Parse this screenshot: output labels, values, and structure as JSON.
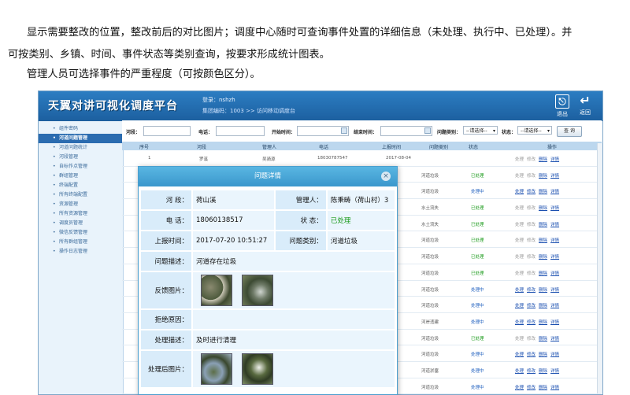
{
  "doc": {
    "p1": "显示需要整改的位置，整改前后的对比图片；调度中心随时可查询事件处置的详细信息（未处理、执行中、已处理）。并",
    "p2": "可按类别、乡镇、时间、事件状态等类别查询，按要求形成统计图表。",
    "p3": "管理人员可选择事件的严重程度（可按颜色区分）。"
  },
  "app": {
    "title": "天翼对讲可视化调度平台",
    "user_label": "登录：",
    "user_name": "nshzh",
    "group_line": "集团编码：1003",
    "crumb": ">> 访问移动调度台",
    "exit_label": "退出",
    "back_label": "返回"
  },
  "sidebar": {
    "items": [
      {
        "label": "组件密码"
      },
      {
        "label": "河道问题管理"
      },
      {
        "label": "河道问题统计"
      },
      {
        "label": "河段管理"
      },
      {
        "label": "自标作点管理"
      },
      {
        "label": "群组管理"
      },
      {
        "label": "终端配置"
      },
      {
        "label": "所有终端配置"
      },
      {
        "label": "资源管理"
      },
      {
        "label": "所有资源管理"
      },
      {
        "label": "调度员管理"
      },
      {
        "label": "微信反馈管理"
      },
      {
        "label": "所有群组管理"
      },
      {
        "label": "操作日志管理"
      }
    ],
    "active_index": 1
  },
  "filters": {
    "reach_label": "河段：",
    "phone_label": "电话：",
    "start_label": "开始时间：",
    "end_label": "结束时间：",
    "type_label": "问题类别：",
    "type_value": "--请选择--",
    "status_label": "状态：",
    "status_value": "--请选择--",
    "query_label": "查 询"
  },
  "grid": {
    "headers": [
      "序号",
      "河段",
      "管理人",
      "电话",
      "上报时间",
      "问题类别",
      "状态",
      "操作"
    ],
    "ops": [
      "处理",
      "修改",
      "删除",
      "详情"
    ],
    "rows": [
      {
        "no": "1",
        "reach": "罗溪",
        "manager": "吴骑源",
        "phone": "18030787547",
        "time": "2017-08-04",
        "type": "",
        "status": "",
        "status_class": "",
        "ops_live": [
          false,
          false,
          true,
          true
        ]
      },
      {
        "no": "",
        "reach": "",
        "manager": "",
        "phone": "",
        "time": "",
        "type": "河道垃圾",
        "status": "已处理",
        "status_class": "st-done",
        "ops_live": [
          false,
          false,
          true,
          true
        ]
      },
      {
        "no": "",
        "reach": "",
        "manager": "",
        "phone": "",
        "time": "",
        "type": "河道垃圾",
        "status": "处理中",
        "status_class": "st-doing",
        "ops_live": [
          true,
          true,
          true,
          true
        ]
      },
      {
        "no": "",
        "reach": "",
        "manager": "",
        "phone": "",
        "time": "",
        "type": "水土流失",
        "status": "已处理",
        "status_class": "st-done",
        "ops_live": [
          false,
          false,
          true,
          true
        ]
      },
      {
        "no": "",
        "reach": "",
        "manager": "",
        "phone": "",
        "time": "",
        "type": "水土流失",
        "status": "已处理",
        "status_class": "st-done",
        "ops_live": [
          false,
          false,
          true,
          true
        ]
      },
      {
        "no": "",
        "reach": "",
        "manager": "",
        "phone": "",
        "time": "",
        "type": "河道垃圾",
        "status": "已处理",
        "status_class": "st-done",
        "ops_live": [
          false,
          false,
          true,
          true
        ]
      },
      {
        "no": "",
        "reach": "",
        "manager": "",
        "phone": "",
        "time": "",
        "type": "河道垃圾",
        "status": "已处理",
        "status_class": "st-done",
        "ops_live": [
          false,
          false,
          true,
          true
        ]
      },
      {
        "no": "",
        "reach": "",
        "manager": "",
        "phone": "",
        "time": "",
        "type": "河道垃圾",
        "status": "已处理",
        "status_class": "st-done",
        "ops_live": [
          false,
          false,
          true,
          true
        ]
      },
      {
        "no": "",
        "reach": "",
        "manager": "",
        "phone": "",
        "time": "",
        "type": "河道垃圾",
        "status": "处理中",
        "status_class": "st-doing",
        "ops_live": [
          true,
          true,
          true,
          true
        ]
      },
      {
        "no": "",
        "reach": "",
        "manager": "",
        "phone": "",
        "time": "",
        "type": "河道垃圾",
        "status": "处理中",
        "status_class": "st-doing",
        "ops_live": [
          true,
          true,
          true,
          true
        ]
      },
      {
        "no": "",
        "reach": "",
        "manager": "",
        "phone": "",
        "time": "",
        "type": "河岸违建",
        "status": "处理中",
        "status_class": "st-doing",
        "ops_live": [
          true,
          true,
          true,
          true
        ]
      },
      {
        "no": "",
        "reach": "",
        "manager": "",
        "phone": "",
        "time": "",
        "type": "河道垃圾",
        "status": "已处理",
        "status_class": "st-done",
        "ops_live": [
          false,
          false,
          true,
          true
        ]
      },
      {
        "no": "",
        "reach": "",
        "manager": "",
        "phone": "",
        "time": "",
        "type": "河道垃圾",
        "status": "处理中",
        "status_class": "st-doing",
        "ops_live": [
          true,
          true,
          true,
          true
        ]
      },
      {
        "no": "",
        "reach": "",
        "manager": "",
        "phone": "",
        "time": "",
        "type": "河道淤塞",
        "status": "处理中",
        "status_class": "st-doing",
        "ops_live": [
          true,
          true,
          true,
          true
        ]
      },
      {
        "no": "",
        "reach": "",
        "manager": "",
        "phone": "",
        "time": "",
        "type": "河道垃圾",
        "status": "处理中",
        "status_class": "st-doing",
        "ops_live": [
          true,
          true,
          true,
          true
        ]
      }
    ]
  },
  "modal": {
    "title": "问题详情",
    "reach_label": "河  段：",
    "reach_value": "荷山溪",
    "manager_label": "管理人：",
    "manager_value": "陈秉畴（荷山村）3",
    "phone_label": "电  话：",
    "phone_value": "18060138517",
    "status_label": "状  态：",
    "status_value": "已处理",
    "time_label": "上报时间：",
    "time_value": "2017-07-20 10:51:27",
    "type_label": "问题类别：",
    "type_value": "河道垃圾",
    "desc_label": "问题描述：",
    "desc_value": "河道存在垃圾",
    "feedback_label": "反馈图片：",
    "reject_label": "拒绝原因：",
    "reject_value": "",
    "handle_label": "处理描述：",
    "handle_value": "及时进行清理",
    "after_label": "处理后图片："
  }
}
